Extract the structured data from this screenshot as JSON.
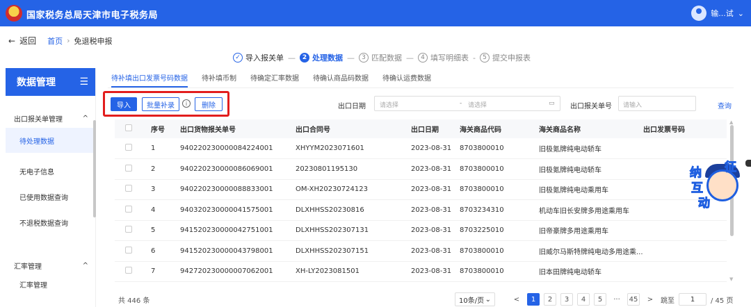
{
  "header": {
    "brand": "国家税务总局天津市电子税务局",
    "user_name": "输...试"
  },
  "breadcrumb": {
    "back": "返回",
    "home": "首页",
    "current": "免退税申报"
  },
  "steps": [
    {
      "num": "✓",
      "label": "导入报关单"
    },
    {
      "num": "2",
      "label": "处理数据"
    },
    {
      "num": "3",
      "label": "匹配数据"
    },
    {
      "num": "4",
      "label": "填写明细表"
    },
    {
      "num": "5",
      "label": "提交申报表"
    }
  ],
  "sidebar": {
    "title": "数据管理",
    "group1": "出口报关单管理",
    "items": [
      "待处理数据",
      "无电子信息",
      "已使用数据查询",
      "不退税数据查询"
    ],
    "group2": "汇率管理",
    "sub2": "汇率管理"
  },
  "tabs": [
    "待补填出口发票号码数据",
    "待补填币制",
    "待确定汇率数据",
    "待确认商品码数据",
    "待确认运费数据"
  ],
  "toolbar": {
    "import": "导入",
    "batch": "批量补录",
    "delete": "删除"
  },
  "filters": {
    "date_label": "出口日期",
    "date_start": "请选择",
    "date_sep": "-",
    "date_end": "请选择",
    "decl_label": "出口报关单号",
    "decl_placeholder": "请输入",
    "query": "查询"
  },
  "table": {
    "headers": [
      "序号",
      "出口货物报关单号",
      "出口合同号",
      "出口日期",
      "海关商品代码",
      "海关商品名称",
      "出口发票号码"
    ],
    "rows": [
      [
        "1",
        "940220230000084224001",
        "XHYYM2023071601",
        "2023-08-31",
        "8703800010",
        "旧极氪牌纯电动轿车",
        ""
      ],
      [
        "2",
        "940220230000086069001",
        "20230801195130",
        "2023-08-31",
        "8703800010",
        "旧极氪牌纯电动轿车",
        ""
      ],
      [
        "3",
        "940220230000088833001",
        "OM-XH20230724123",
        "2023-08-31",
        "8703800010",
        "旧极氪牌纯电动乘用车",
        ""
      ],
      [
        "4",
        "940320230000041575001",
        "DLXHHSS20230816",
        "2023-08-31",
        "8703234310",
        "机动车旧长安牌多用途乘用车",
        ""
      ],
      [
        "5",
        "941520230000042751001",
        "DLXHHSS202307131",
        "2023-08-31",
        "8703225010",
        "旧帝豪牌多用途乘用车",
        ""
      ],
      [
        "6",
        "941520230000043798001",
        "DLXHHSS202307151",
        "2023-08-31",
        "8703800010",
        "旧威尔马斯特牌纯电动多用途乘...",
        ""
      ],
      [
        "7",
        "942720230000007062001",
        "XH-LY2023081501",
        "2023-08-31",
        "8703800010",
        "旧本田牌纯电动轿车",
        ""
      ]
    ]
  },
  "mascot": {
    "chars": [
      "征",
      "纳",
      "互",
      "动"
    ]
  },
  "pagination": {
    "total": "共 446 条",
    "page_size": "10条/页",
    "prev": "<",
    "pages": [
      "1",
      "2",
      "3",
      "4",
      "5"
    ],
    "ellipsis": "···",
    "last": "45",
    "next": ">",
    "jump_label": "跳至",
    "jump_value": "1",
    "page_count": "/ 45 页"
  }
}
